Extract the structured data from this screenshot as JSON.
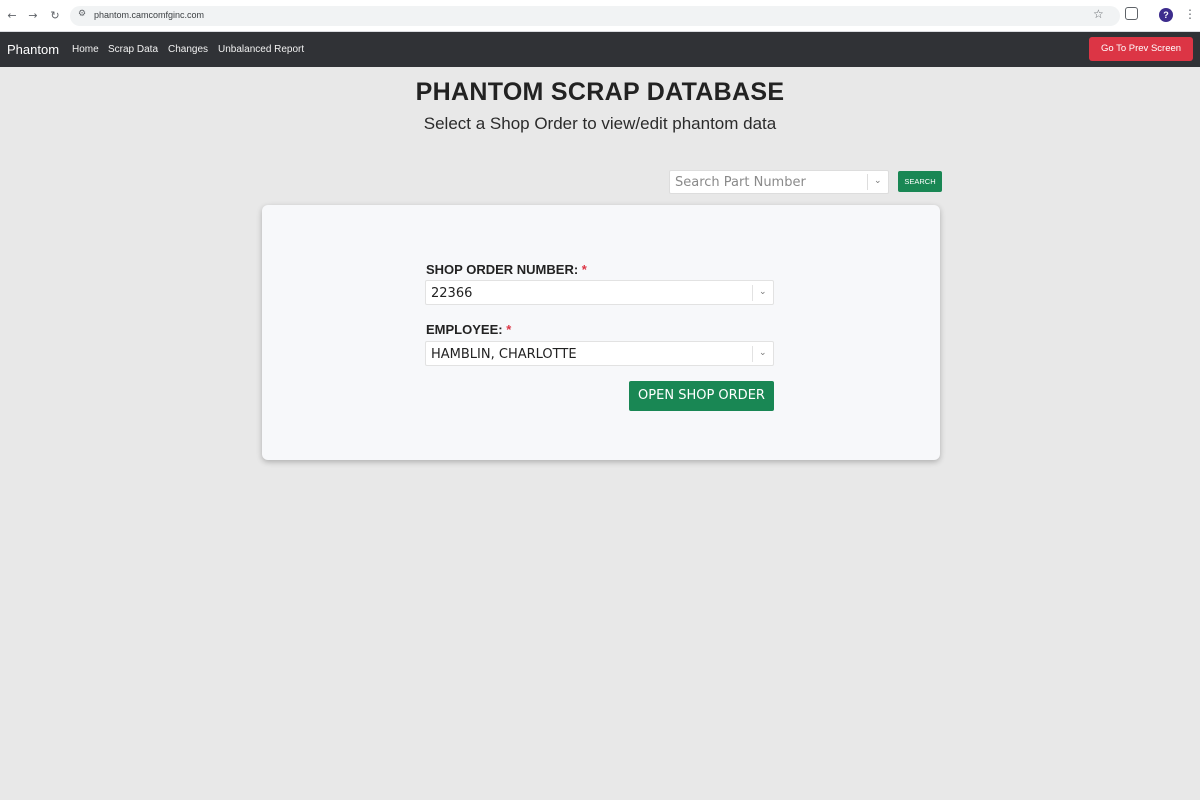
{
  "browser": {
    "url": "phantom.camcomfginc.com",
    "back_icon": "arrow-left",
    "forward_icon": "arrow-right",
    "reload_icon": "reload",
    "site_settings_icon": "tune",
    "bookmark_icon": "star",
    "extensions_icon": "puzzle",
    "profile_initial": "?",
    "menu_icon": "kebab"
  },
  "navbar": {
    "brand": "Phantom",
    "links": [
      "Home",
      "Scrap Data",
      "Changes",
      "Unbalanced Report"
    ],
    "prev_button": "Go To Prev Screen",
    "colors": {
      "background": "#303236",
      "prev_button": "#dc3545"
    }
  },
  "page": {
    "title": "PHANTOM SCRAP DATABASE",
    "subtitle": "Select a Shop Order to view/edit phantom data"
  },
  "search": {
    "placeholder": "Search Part Number",
    "button": "SEARCH",
    "button_color": "#198754"
  },
  "form": {
    "shop_order": {
      "label": "SHOP ORDER NUMBER:",
      "required_mark": "*",
      "value": "22366"
    },
    "employee": {
      "label": "EMPLOYEE:",
      "required_mark": "*",
      "value": "HAMBLIN, CHARLOTTE"
    },
    "submit": "OPEN SHOP ORDER"
  }
}
